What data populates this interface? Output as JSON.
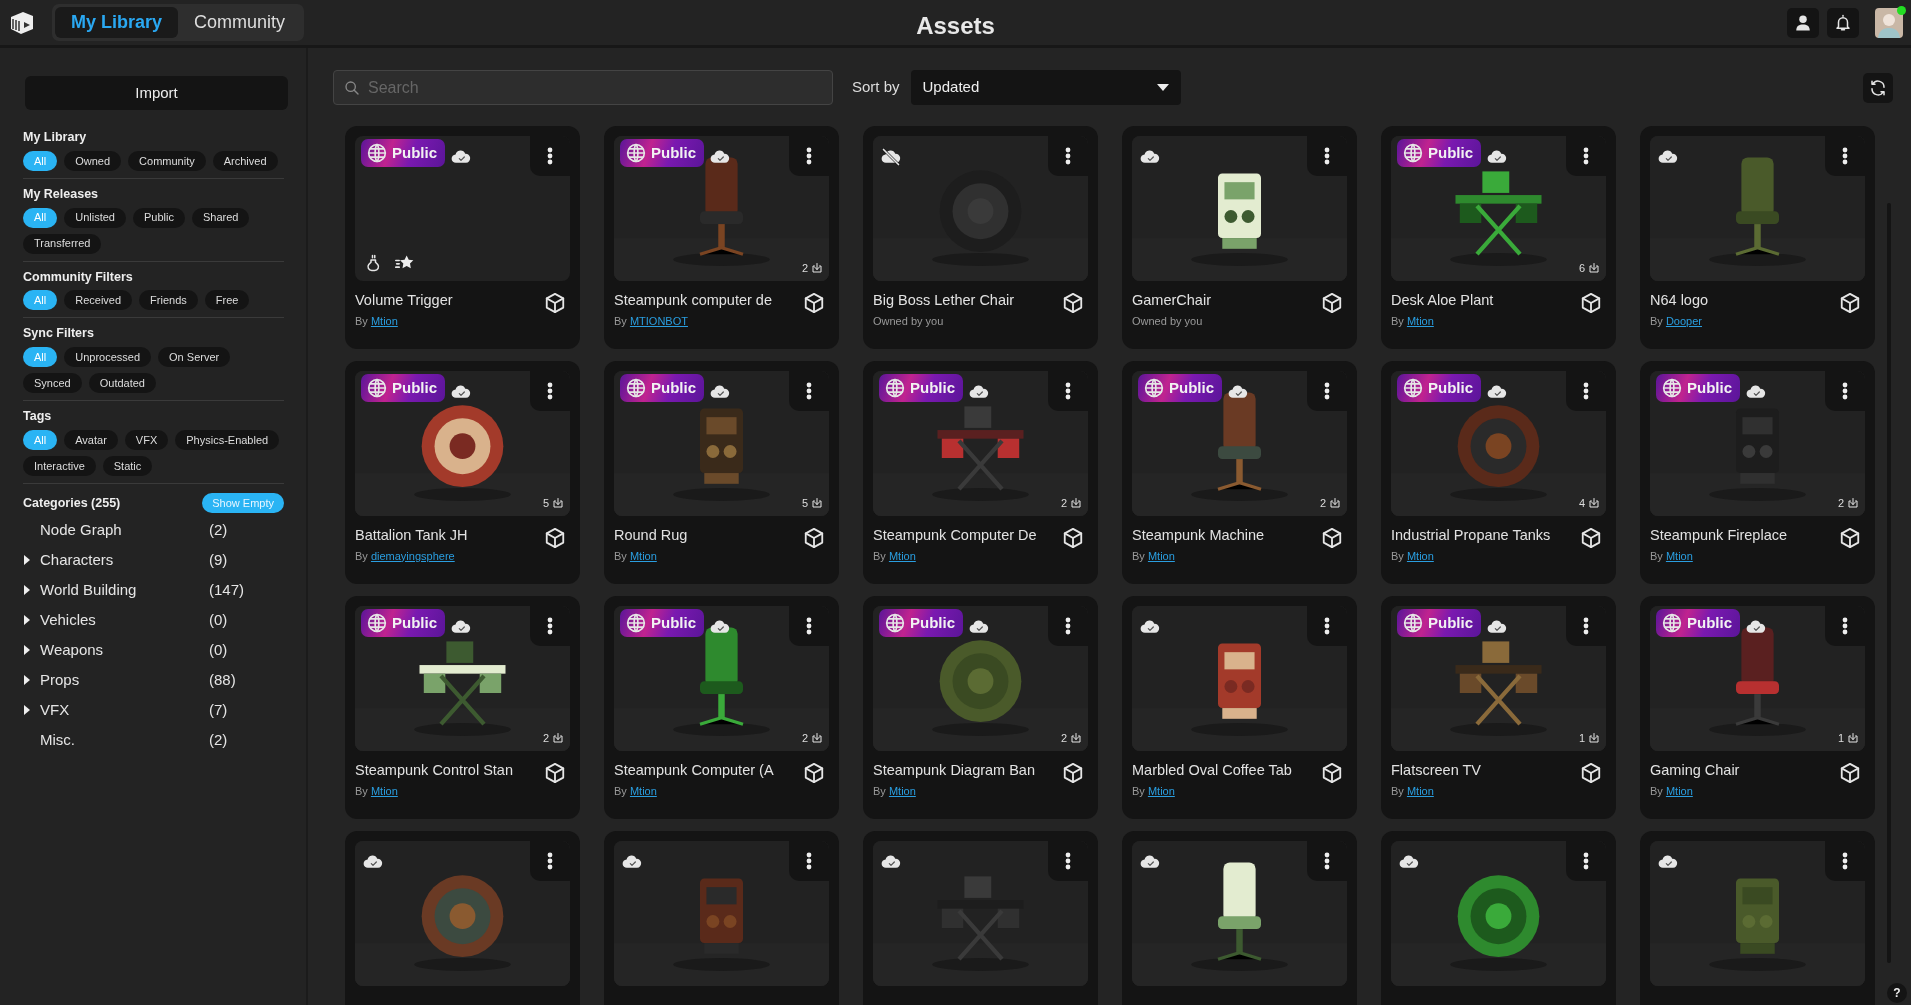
{
  "header": {
    "tabs": [
      {
        "label": "My Library",
        "selected": true
      },
      {
        "label": "Community",
        "selected": false
      }
    ],
    "title": "Assets",
    "user_online": true
  },
  "sidebar": {
    "import_label": "Import",
    "filter_groups": [
      {
        "title": "My Library",
        "chips": [
          {
            "label": "All",
            "selected": true
          },
          {
            "label": "Owned",
            "selected": false
          },
          {
            "label": "Community",
            "selected": false
          },
          {
            "label": "Archived",
            "selected": false
          }
        ]
      },
      {
        "title": "My Releases",
        "chips": [
          {
            "label": "All",
            "selected": true
          },
          {
            "label": "Unlisted",
            "selected": false
          },
          {
            "label": "Public",
            "selected": false
          },
          {
            "label": "Shared",
            "selected": false
          },
          {
            "label": "Transferred",
            "selected": false
          }
        ]
      },
      {
        "title": "Community Filters",
        "chips": [
          {
            "label": "All",
            "selected": true
          },
          {
            "label": "Received",
            "selected": false
          },
          {
            "label": "Friends",
            "selected": false
          },
          {
            "label": "Free",
            "selected": false
          }
        ]
      },
      {
        "title": "Sync Filters",
        "chips": [
          {
            "label": "All",
            "selected": true
          },
          {
            "label": "Unprocessed",
            "selected": false
          },
          {
            "label": "On Server",
            "selected": false
          },
          {
            "label": "Synced",
            "selected": false
          },
          {
            "label": "Outdated",
            "selected": false
          }
        ]
      },
      {
        "title": "Tags",
        "chips": [
          {
            "label": "All",
            "selected": true
          },
          {
            "label": "Avatar",
            "selected": false
          },
          {
            "label": "VFX",
            "selected": false
          },
          {
            "label": "Physics-Enabled",
            "selected": false
          },
          {
            "label": "Interactive",
            "selected": false
          },
          {
            "label": "Static",
            "selected": false
          }
        ]
      }
    ],
    "categories": {
      "title": "Categories (255)",
      "show_empty_label": "Show Empty",
      "items": [
        {
          "name": "Node Graph",
          "count": "(2)",
          "expandable": false
        },
        {
          "name": "Characters",
          "count": "(9)",
          "expandable": true
        },
        {
          "name": "World Building",
          "count": "(147)",
          "expandable": true
        },
        {
          "name": "Vehicles",
          "count": "(0)",
          "expandable": true
        },
        {
          "name": "Weapons",
          "count": "(0)",
          "expandable": true
        },
        {
          "name": "Props",
          "count": "(88)",
          "expandable": true
        },
        {
          "name": "VFX",
          "count": "(7)",
          "expandable": true
        },
        {
          "name": "Misc.",
          "count": "(2)",
          "expandable": false
        }
      ]
    }
  },
  "toolbar": {
    "search": {
      "placeholder": "Search"
    },
    "sort_label": "Sort by",
    "sort_value": "Updated"
  },
  "assets": [
    {
      "kind": "trigger",
      "badge": "Public",
      "synced": true,
      "title": "Volume Trigger",
      "byline": "By",
      "author": "Mtion"
    },
    {
      "kind": "model",
      "badge": "Public",
      "synced": true,
      "downloads": "2",
      "title": "Steampunk computer de",
      "byline": "By",
      "author": "MTIONBOT"
    },
    {
      "kind": "model",
      "synced": false,
      "title": "Big Boss Lether Chair",
      "byline": "Owned by you"
    },
    {
      "kind": "model",
      "synced": true,
      "title": "GamerChair",
      "byline": "Owned by you"
    },
    {
      "kind": "model",
      "badge": "Public",
      "synced": true,
      "downloads": "6",
      "title": "Desk Aloe Plant",
      "byline": "By",
      "author": "Mtion"
    },
    {
      "kind": "model",
      "synced": true,
      "title": "N64 logo",
      "byline": "By",
      "author": "Dooper"
    },
    {
      "kind": "model",
      "badge": "Public",
      "synced": true,
      "downloads": "5",
      "title": "Battalion Tank JH",
      "byline": "By",
      "author": "diemayingsphere"
    },
    {
      "kind": "model",
      "badge": "Public",
      "synced": true,
      "downloads": "5",
      "title": "Round Rug",
      "byline": "By",
      "author": "Mtion"
    },
    {
      "kind": "model",
      "badge": "Public",
      "synced": true,
      "downloads": "2",
      "title": "Steampunk Computer De",
      "byline": "By",
      "author": "Mtion"
    },
    {
      "kind": "model",
      "badge": "Public",
      "synced": true,
      "downloads": "2",
      "title": "Steampunk Machine",
      "byline": "By",
      "author": "Mtion"
    },
    {
      "kind": "model",
      "badge": "Public",
      "synced": true,
      "downloads": "4",
      "title": "Industrial Propane Tanks",
      "byline": "By",
      "author": "Mtion"
    },
    {
      "kind": "model",
      "badge": "Public",
      "synced": true,
      "downloads": "2",
      "title": "Steampunk Fireplace",
      "byline": "By",
      "author": "Mtion"
    },
    {
      "kind": "model",
      "badge": "Public",
      "synced": true,
      "downloads": "2",
      "title": "Steampunk Control Stan",
      "byline": "By",
      "author": "Mtion"
    },
    {
      "kind": "model",
      "badge": "Public",
      "synced": true,
      "downloads": "2",
      "title": "Steampunk Computer (A",
      "byline": "By",
      "author": "Mtion"
    },
    {
      "kind": "model",
      "badge": "Public",
      "synced": true,
      "downloads": "2",
      "title": "Steampunk Diagram Ban",
      "byline": "By",
      "author": "Mtion"
    },
    {
      "kind": "model",
      "synced": true,
      "title": "Marbled Oval Coffee Tab",
      "byline": "By",
      "author": "Mtion"
    },
    {
      "kind": "model",
      "badge": "Public",
      "synced": true,
      "downloads": "1",
      "title": "Flatscreen TV",
      "byline": "By",
      "author": "Mtion"
    },
    {
      "kind": "model",
      "badge": "Public",
      "synced": true,
      "downloads": "1",
      "title": "Gaming Chair",
      "byline": "By",
      "author": "Mtion"
    },
    {
      "kind": "model",
      "synced": true
    },
    {
      "kind": "model",
      "synced": true
    },
    {
      "kind": "model",
      "synced": true
    },
    {
      "kind": "model",
      "synced": true
    },
    {
      "kind": "model",
      "synced": true
    },
    {
      "kind": "model",
      "synced": true
    }
  ],
  "help_label": "?"
}
